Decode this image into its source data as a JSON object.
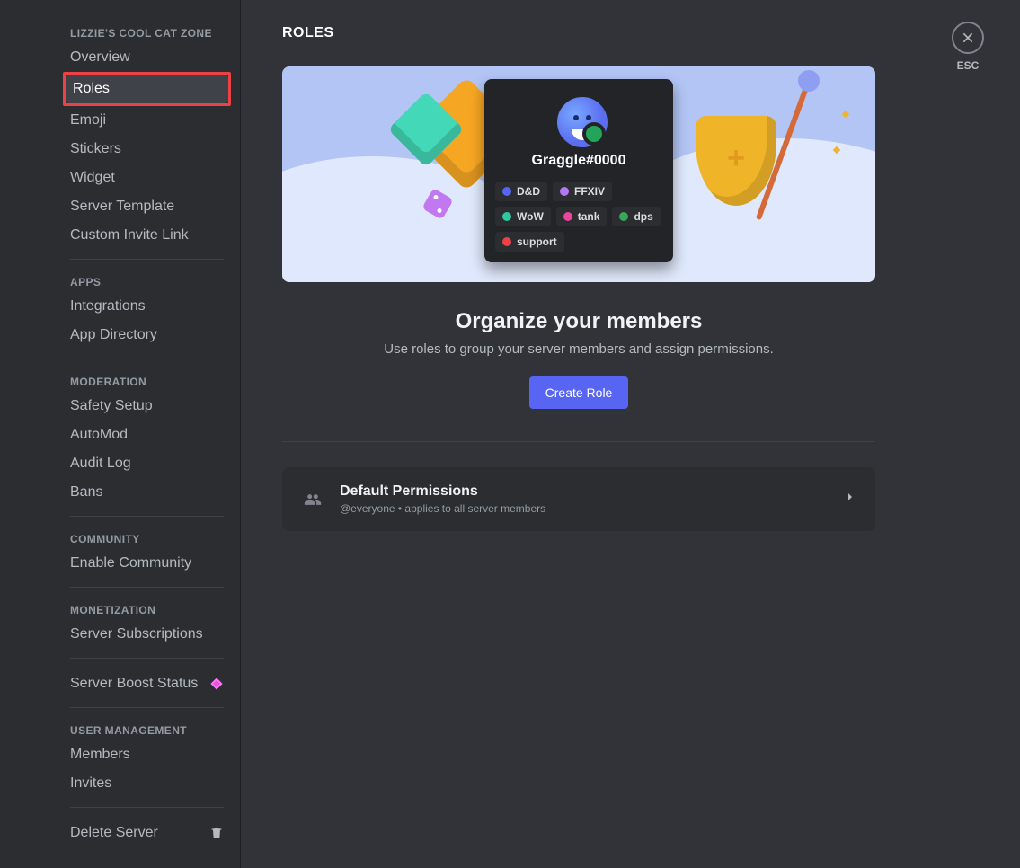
{
  "page": {
    "title": "ROLES",
    "esc_label": "ESC"
  },
  "sidebar": {
    "server_name": "LIZZIE'S COOL CAT ZONE",
    "sections": {
      "main": [
        "Overview",
        "Roles",
        "Emoji",
        "Stickers",
        "Widget",
        "Server Template",
        "Custom Invite Link"
      ],
      "apps_header": "APPS",
      "apps": [
        "Integrations",
        "App Directory"
      ],
      "moderation_header": "MODERATION",
      "moderation": [
        "Safety Setup",
        "AutoMod",
        "Audit Log",
        "Bans"
      ],
      "community_header": "COMMUNITY",
      "community": [
        "Enable Community"
      ],
      "monetization_header": "MONETIZATION",
      "monetization": [
        "Server Subscriptions"
      ],
      "boost": "Server Boost Status",
      "user_mgmt_header": "USER MANAGEMENT",
      "user_mgmt": [
        "Members",
        "Invites"
      ],
      "delete": "Delete Server"
    }
  },
  "profile": {
    "username": "Graggle#0000",
    "roles": [
      {
        "label": "D&D",
        "color": "#5865f2"
      },
      {
        "label": "FFXIV",
        "color": "#b377f3"
      },
      {
        "label": "WoW",
        "color": "#2dc9a0"
      },
      {
        "label": "tank",
        "color": "#eb459e"
      },
      {
        "label": "dps",
        "color": "#3ba55c"
      },
      {
        "label": "support",
        "color": "#ed4245"
      }
    ]
  },
  "organize": {
    "heading": "Organize your members",
    "subtext": "Use roles to group your server members and assign permissions.",
    "button": "Create Role"
  },
  "default_perm": {
    "title": "Default Permissions",
    "subtitle": "@everyone • applies to all server members"
  }
}
